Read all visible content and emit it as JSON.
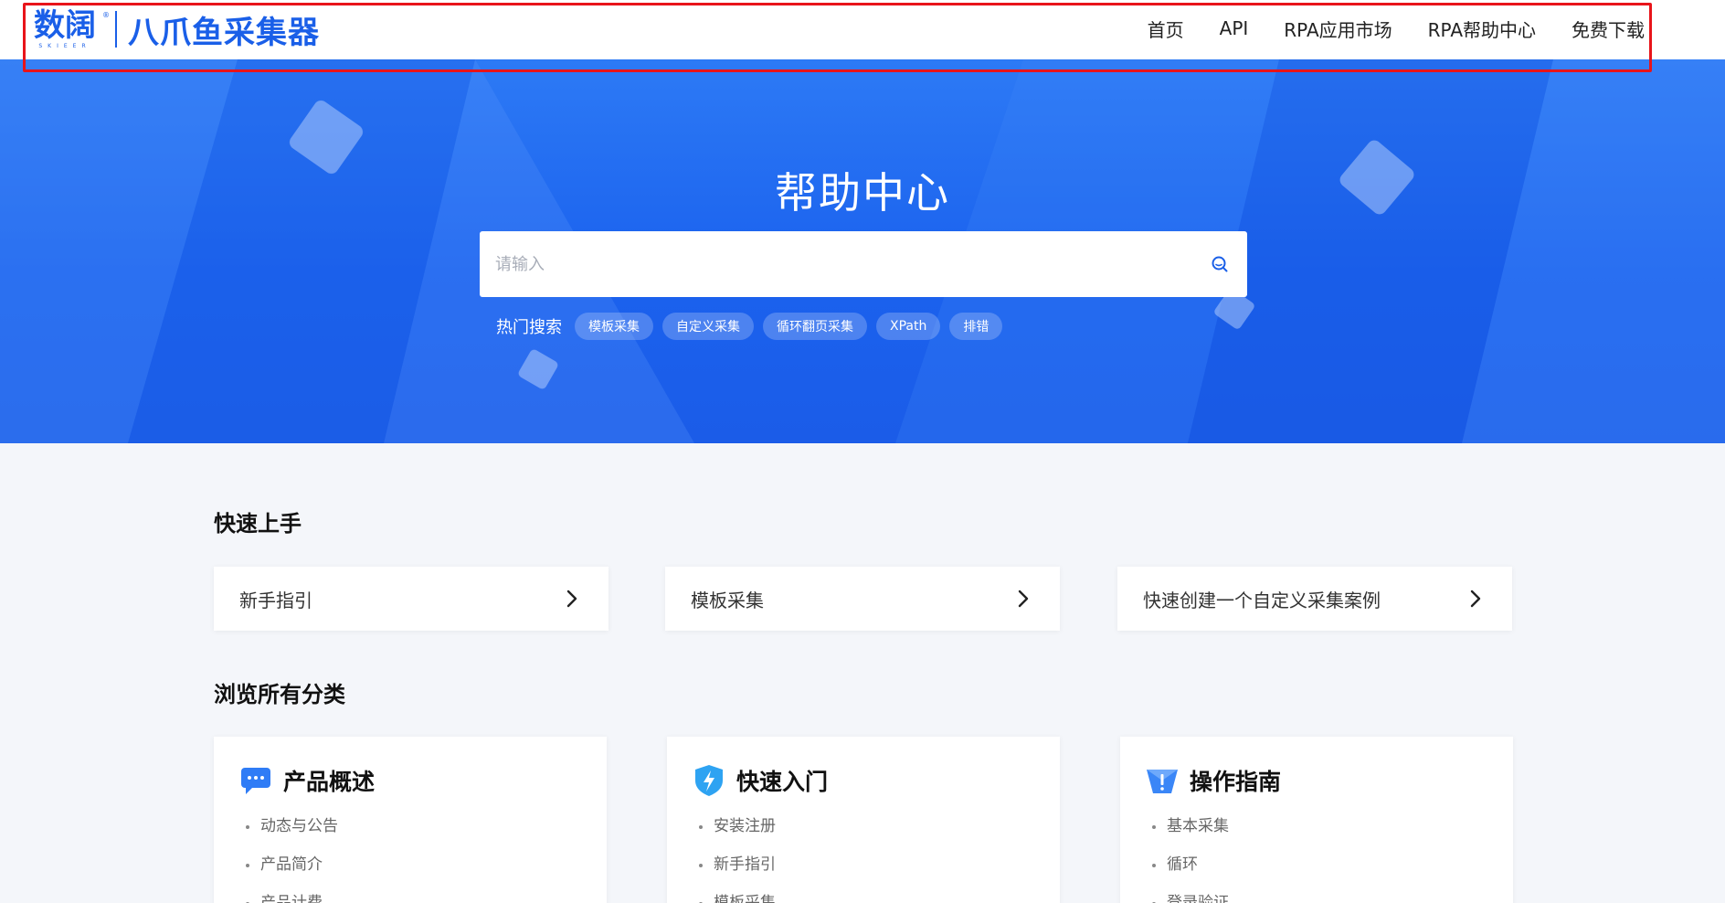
{
  "header": {
    "logo_cn": "数阔",
    "logo_en": "SKIEER",
    "logo_reg": "®",
    "brand_name": "八爪鱼采集器",
    "nav": [
      {
        "label": "首页"
      },
      {
        "label": "API"
      },
      {
        "label": "RPA应用市场"
      },
      {
        "label": "RPA帮助中心"
      },
      {
        "label": "免费下载"
      }
    ]
  },
  "hero": {
    "title": "帮助中心",
    "search": {
      "placeholder": "请输入",
      "value": ""
    },
    "hot_label": "热门搜索",
    "hot_tags": [
      {
        "label": "模板采集"
      },
      {
        "label": "自定义采集"
      },
      {
        "label": "循环翻页采集"
      },
      {
        "label": "XPath"
      },
      {
        "label": "排错"
      }
    ]
  },
  "quick_start": {
    "title": "快速上手",
    "cards": [
      {
        "label": "新手指引"
      },
      {
        "label": "模板采集"
      },
      {
        "label": "快速创建一个自定义采集案例"
      }
    ]
  },
  "categories": {
    "title": "浏览所有分类",
    "items": [
      {
        "title": "产品概述",
        "icon": "chat-bubble-icon",
        "links": [
          "动态与公告",
          "产品简介",
          "产品计费"
        ]
      },
      {
        "title": "快速入门",
        "icon": "lightning-shield-icon",
        "links": [
          "安装注册",
          "新手指引",
          "模板采集"
        ]
      },
      {
        "title": "操作指南",
        "icon": "exclamation-flag-icon",
        "links": [
          "基本采集",
          "循环",
          "登录验证"
        ]
      }
    ]
  },
  "colors": {
    "brand_blue": "#1a5fe8",
    "hero_blue": "#1b62ee",
    "highlight_frame": "#e8141a",
    "page_bg": "#f4f6fa"
  }
}
